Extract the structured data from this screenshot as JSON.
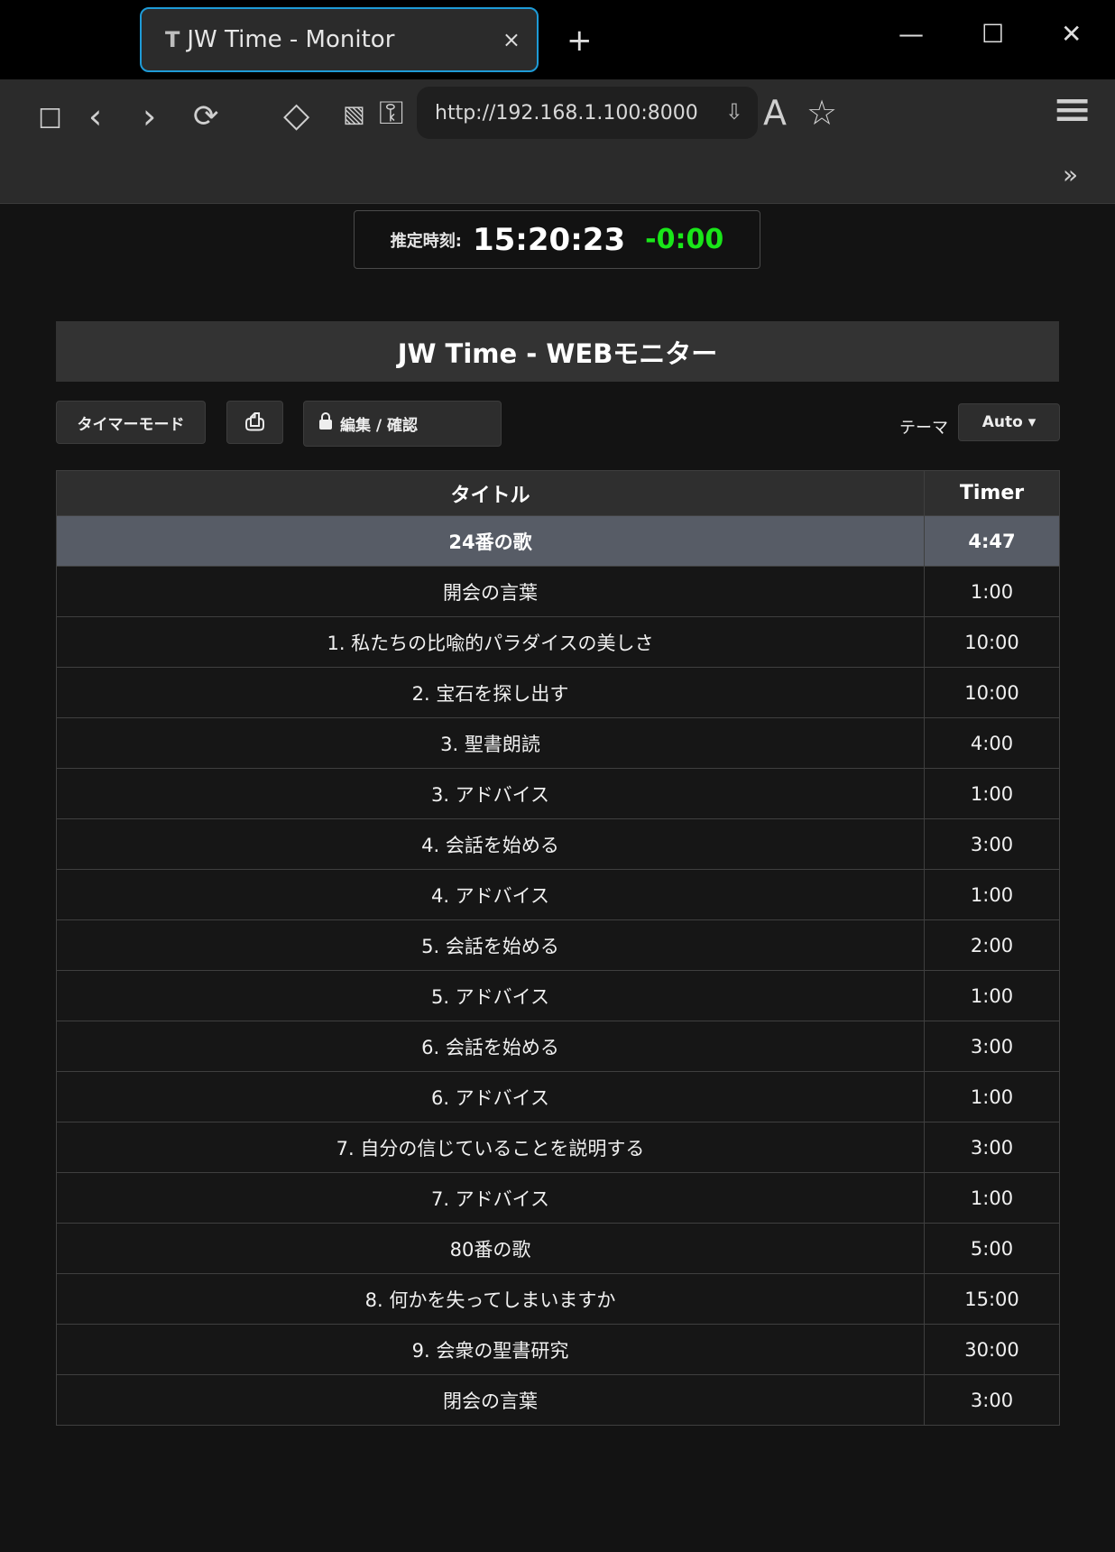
{
  "browser": {
    "tab": {
      "favicon": "T",
      "title": "JW Time - Monitor",
      "close": "×"
    },
    "new_tab": "+",
    "window": {
      "minimize": "—",
      "maximize": "☐",
      "close": "✕"
    },
    "toolbar": {
      "sidebar_icon": "☐",
      "back_icon": "‹",
      "forward_icon": "›",
      "reload_icon": "⟳",
      "ext1_icon": "◇",
      "ext2_icon": "▧",
      "ext3_icon": "⚿",
      "url": "http://192.168.1.100:8000",
      "download_icon": "⇩",
      "reader_icon": "A",
      "star_icon": "☆",
      "menu_icon": "≡",
      "overflow_icon": "»"
    }
  },
  "clock": {
    "label": "推定時刻:",
    "time": "15:20:23",
    "diff": "-0:00",
    "diff_color": "#19e619"
  },
  "page": {
    "title": "JW Time - WEBモニター",
    "timer_mode_button": "タイマーモード",
    "print_icon": "⎙",
    "edit_button": "編集 / 確認",
    "theme_label": "テーマ",
    "theme_value": "Auto ▾"
  },
  "table": {
    "headers": [
      "タイトル",
      "Timer"
    ],
    "rows": [
      {
        "title": "24番の歌",
        "timer": "4:47",
        "current": true
      },
      {
        "title": "開会の言葉",
        "timer": "1:00"
      },
      {
        "title": "1. 私たちの比喩的パラダイスの美しさ",
        "timer": "10:00"
      },
      {
        "title": "2. 宝石を探し出す",
        "timer": "10:00"
      },
      {
        "title": "3. 聖書朗読",
        "timer": "4:00"
      },
      {
        "title": "3. アドバイス",
        "timer": "1:00"
      },
      {
        "title": "4. 会話を始める",
        "timer": "3:00"
      },
      {
        "title": "4. アドバイス",
        "timer": "1:00"
      },
      {
        "title": "5. 会話を始める",
        "timer": "2:00"
      },
      {
        "title": "5. アドバイス",
        "timer": "1:00"
      },
      {
        "title": "6. 会話を始める",
        "timer": "3:00"
      },
      {
        "title": "6. アドバイス",
        "timer": "1:00"
      },
      {
        "title": "7. 自分の信じていることを説明する",
        "timer": "3:00"
      },
      {
        "title": "7. アドバイス",
        "timer": "1:00"
      },
      {
        "title": "80番の歌",
        "timer": "5:00"
      },
      {
        "title": "8. 何かを失ってしまいますか",
        "timer": "15:00"
      },
      {
        "title": "9. 会衆の聖書研究",
        "timer": "30:00"
      },
      {
        "title": "閉会の言葉",
        "timer": "3:00"
      }
    ]
  }
}
